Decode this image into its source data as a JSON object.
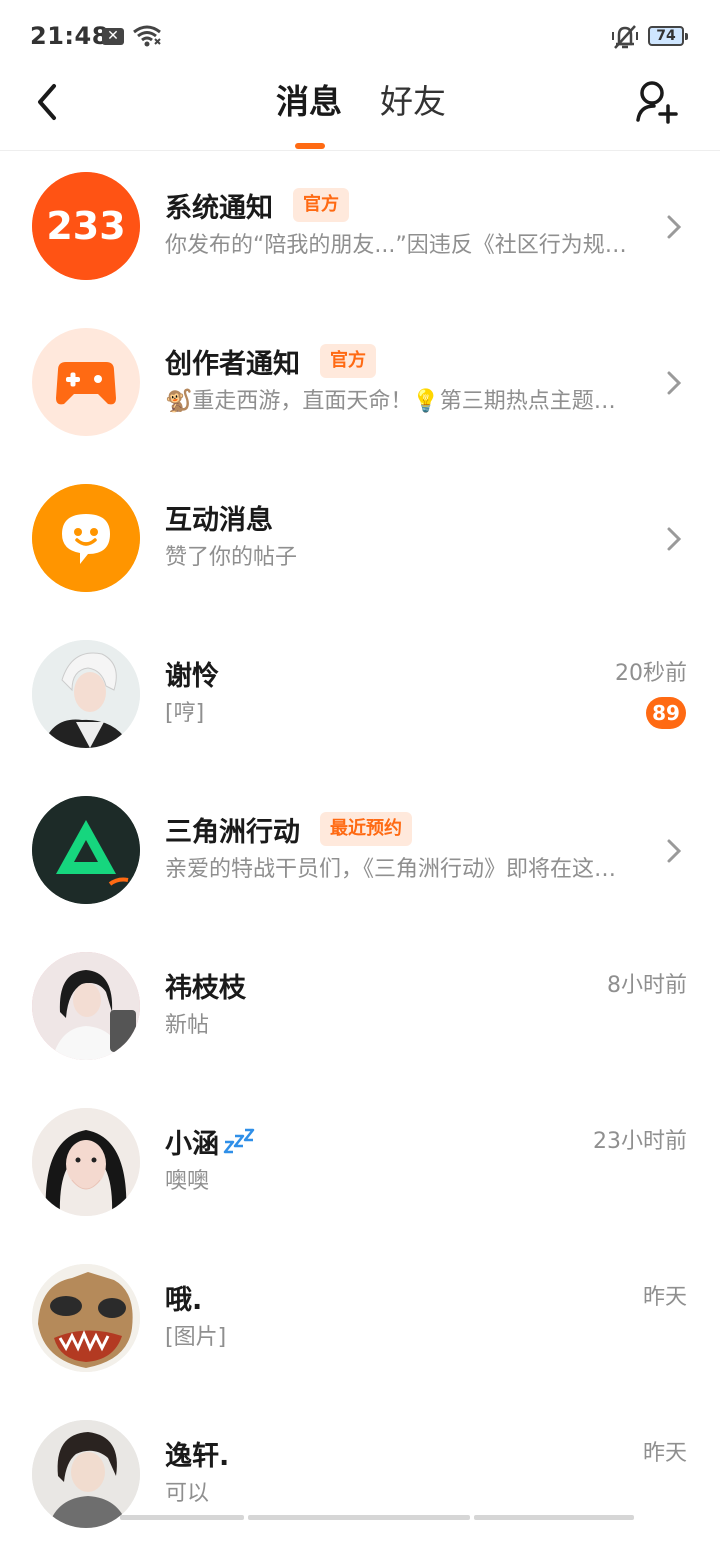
{
  "status_bar": {
    "time": "21:48",
    "notification_icon": "x-app-icon",
    "wifi_icon": "wifi-icon",
    "silent_icon": "bell-muted-icon",
    "battery": "74"
  },
  "header": {
    "tabs": [
      {
        "label": "消息",
        "active": true
      },
      {
        "label": "好友",
        "active": false
      }
    ],
    "back_icon": "back-arrow-icon",
    "add_friend_icon": "add-user-icon"
  },
  "colors": {
    "accent": "#ff6a13",
    "tag_bg": "#ffe9dc",
    "secondary_text": "#8f8f8f"
  },
  "conversations": [
    {
      "name": "系统通知",
      "tag": "官方",
      "subtitle": "你发布的“陪我的朋友...”因违反《社区行为规范》已被处理",
      "avatar_text": "233"
    },
    {
      "name": "创作者通知",
      "tag": "官方",
      "subtitle": "🐒重走西游，直面天命！💡第三期热点主题征稿开启",
      "avatar_icon": "gamepad-plus-icon"
    },
    {
      "name": "互动消息",
      "subtitle": "赞了你的帖子",
      "avatar_icon": "smile-chat-bubble-icon"
    },
    {
      "name": "谢怜",
      "subtitle": "[哼]",
      "time": "20秒前",
      "unread": "89"
    },
    {
      "name": "三角洲行动",
      "tag": "最近预约",
      "subtitle": "亲爱的特战干员们，《三角洲行动》即将在这里与大家见面",
      "avatar_icon": "delta-force-logo-icon"
    },
    {
      "name": "祎枝枝",
      "subtitle": "新帖",
      "time": "8小时前"
    },
    {
      "name": "小涵",
      "name_icon": "zzz-icon",
      "subtitle": "噢噢",
      "time": "23小时前"
    },
    {
      "name": "哦.",
      "subtitle": "[图片]",
      "time": "昨天"
    },
    {
      "name": "逸轩.",
      "subtitle": "可以",
      "time": "昨天"
    }
  ]
}
